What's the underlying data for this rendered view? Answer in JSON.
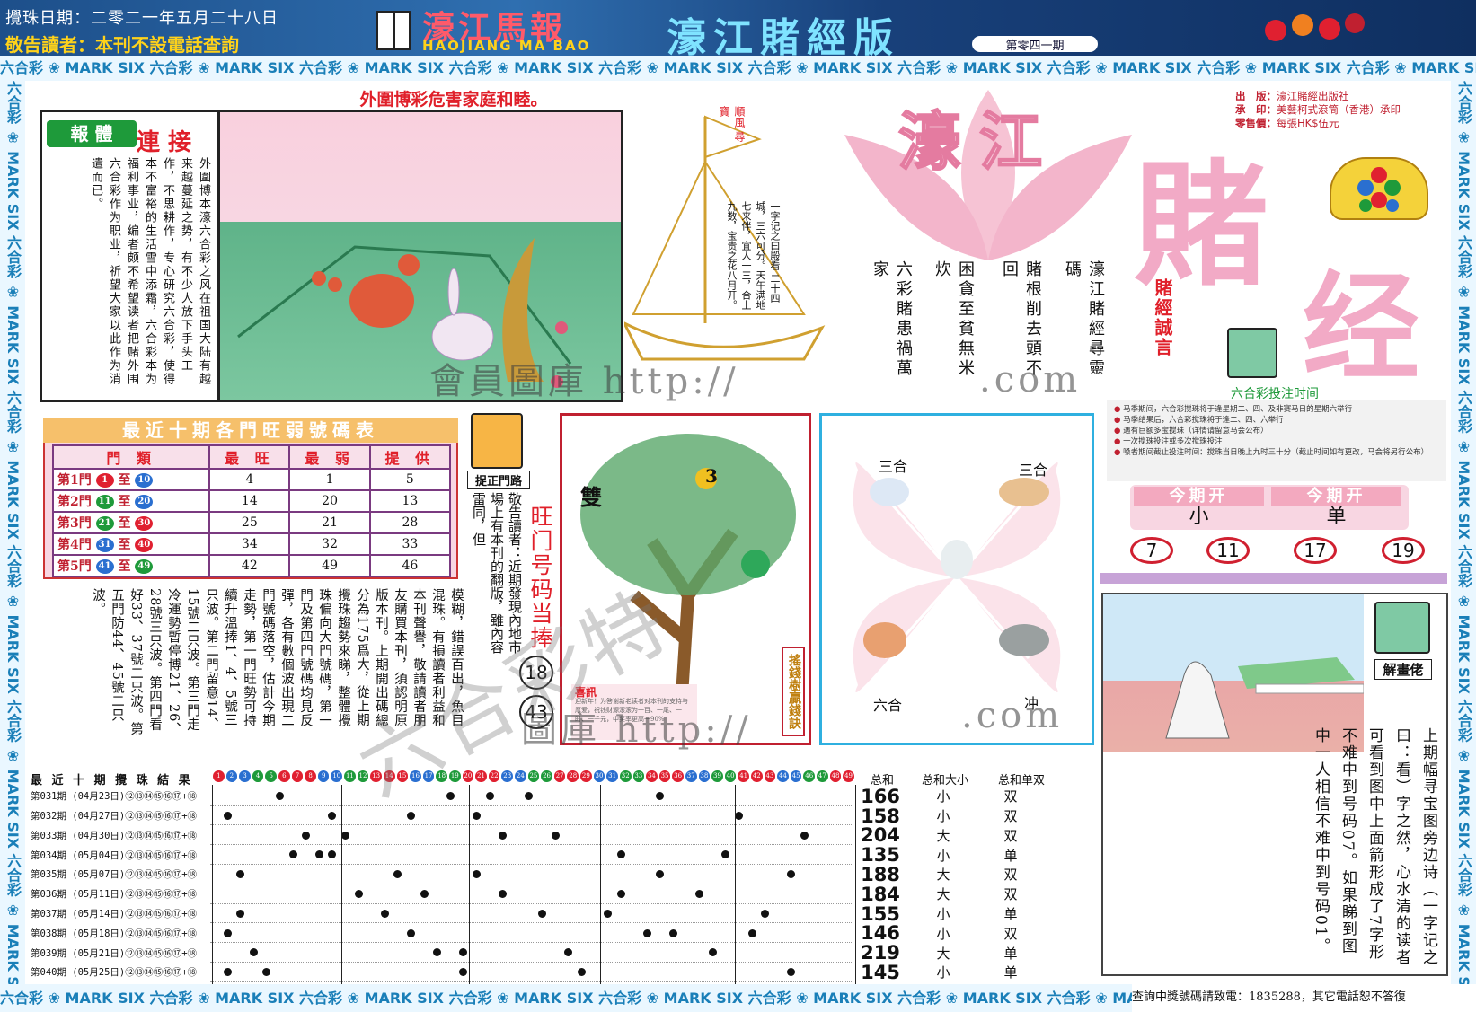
{
  "header": {
    "draw_date": "攪珠日期：二零二一年五月二十八日",
    "notice": "敬告讀者：本刊不設電話查詢",
    "paper_name": "濠江馬報",
    "paper_en": "HAOJIANG MA BAO",
    "edition": "濠江賭經版",
    "issue": "第零四一期"
  },
  "border_text": "六合彩 ❀ MARK SIX 六合彩 ❀ MARK SIX 六合彩 ❀ MARK SIX 六合彩 ❀ MARK SIX 六合彩 ❀ MARK SIX 六合彩 ❀ MARK SIX 六合彩 ❀ MARK SIX 六合彩 ❀ MARK SIX 六合彩 ❀ MARK SIX 六合彩 ❀ MARK SIX",
  "article1": {
    "headline": "外圍博彩危害家庭和睦。",
    "tag": "報 體",
    "tag2": "連 接",
    "text": "外圍博本濠六合彩之风在祖国大陆有越来越蔓延之势，有不少人放下手头工作，不思耕作，专心研究六合彩，使得本不富裕的生活雪中添霜，六合彩本为福利事业，编者颇不希望读者把赌外围六合彩作为职业，祈望大家以此作为消遣而已。"
  },
  "boat": {
    "flag": "順風 尋寶",
    "text": "一字记之曰殿看 二十四城，三六可分。天午满地七来伴，宜人一三，合上九数，宝贵之花八月开。"
  },
  "poems": {
    "p1": "六彩賭患禍萬家",
    "p2": "困貪至貧無米炊",
    "p3": "賭根削去頭不回",
    "p4": "濠江賭經尋靈碼"
  },
  "masthead": {
    "lotus": "濠江",
    "du": "賭",
    "jing": "经",
    "motto": "賭經誠言"
  },
  "publisher": {
    "k1": "出　版：",
    "v1": "濠江賭經出版社",
    "k2": "承　印：",
    "v2": "美藝柯式滾筒（香港）承印",
    "k3": "零售價：",
    "v3": "每張HK$伍元"
  },
  "schedule": {
    "title": "六合彩投注时间",
    "items": [
      "马季期间，六合彩搅珠将于逢星期二、四、及非赛马日的星期六举行",
      "马季结果后，六合彩搅珠将于逢二、四、六举行",
      "遇有巨额多宝搅珠（详情请留意马会公布）",
      "一次搅珠投注或多次搅珠投注",
      "嗓者期间截止投注时间：搅珠当日晚上九时三十分（截止时间如有更改，马会将另行公布）"
    ]
  },
  "this_issue": {
    "h1": "今期开",
    "v1": "小",
    "h2": "今期开",
    "v2": "单",
    "numbers": [
      "7",
      "11",
      "17",
      "19"
    ]
  },
  "table": {
    "title": "最近十期各門旺弱號碼表",
    "headers": [
      "門 類",
      "最 旺",
      "最 弱",
      "提 供"
    ],
    "to": "至",
    "rows": [
      {
        "gate": "第1門",
        "from": "1",
        "to_n": "10",
        "hot": "4",
        "cold": "1",
        "tip": "5"
      },
      {
        "gate": "第2門",
        "from": "11",
        "to_n": "20",
        "hot": "14",
        "cold": "20",
        "tip": "13"
      },
      {
        "gate": "第3門",
        "from": "21",
        "to_n": "30",
        "hot": "25",
        "cold": "21",
        "tip": "28"
      },
      {
        "gate": "第4門",
        "from": "31",
        "to_n": "40",
        "hot": "34",
        "cold": "32",
        "tip": "33"
      },
      {
        "gate": "第5門",
        "from": "41",
        "to_n": "49",
        "hot": "42",
        "cold": "49",
        "tip": "46"
      }
    ]
  },
  "zhuozheng": {
    "label": "捉正門路",
    "apology": "敬告讀者：近期發現內地市場上有本刊的翻版，雖內容雷同，但",
    "wangmen": "旺门号码当捧",
    "n1": "18",
    "n2": "43"
  },
  "column_text": "模糊，錯誤百出，魚目混珠。有損讀者利益和本刊聲譽，敬請讀者朋友購買本刊，須認明原版本刊。上期開出碼總分為175爲大，從上期攪珠趨勢來睇，整體攪珠偏向大門號碼，第一門及第四門號碼均見反彈，各有數個波出現二門號碼落空，估計今期走勢，第一門旺勢可持續升溫捧1、4、5號三只波。第二門留意14、15號二只波。第三門走冷運勢暫停博21、26、28號三只波。第四門看好33、37號二只波。第五門防44、45號二只波。",
  "tree": {
    "shuang": "雙",
    "num": "3",
    "label": "搖錢樹贏錢訣",
    "xixun_title": "喜訊",
    "xixun_text": "迎新年！为答谢新老读者对本刊的支持与厚爱，祝钱财源滚滚为一百、一尾、一时、一千元，中奖率更高一90%"
  },
  "zodiac": {
    "tl": "三合",
    "tr": "三合",
    "bl": "六合",
    "br": "冲"
  },
  "puzzle": {
    "label": "解畫佬",
    "text": "上期幅寻宝图旁边诗（一字记之曰：看）字之然，心水清的读者可看到图中上面箭形成了7字形不难中到号码07。如果睇到图中一人相信不难中到号码01。"
  },
  "results": {
    "title": "最 近 十 期 攪 珠 結 果",
    "sum_h": "总和",
    "dx_h": "总和大小",
    "ds_h": "总和单双",
    "rows": [
      {
        "label": "第031期 (04月23日)⑫⑬⑭⑮⑯⑰+⑱",
        "sum": "166",
        "dx": "小",
        "ds": "双"
      },
      {
        "label": "第032期 (04月27日)⑫⑬⑭⑮⑯⑰+⑱",
        "sum": "158",
        "dx": "小",
        "ds": "双"
      },
      {
        "label": "第033期 (04月30日)⑫⑬⑭⑮⑯⑰+⑱",
        "sum": "204",
        "dx": "大",
        "ds": "双"
      },
      {
        "label": "第034期 (05月04日)⑫⑬⑭⑮⑯⑰+⑱",
        "sum": "135",
        "dx": "小",
        "ds": "单"
      },
      {
        "label": "第035期 (05月07日)⑫⑬⑭⑮⑯⑰+⑱",
        "sum": "188",
        "dx": "大",
        "ds": "双"
      },
      {
        "label": "第036期 (05月11日)⑫⑬⑭⑮⑯⑰+⑱",
        "sum": "184",
        "dx": "大",
        "ds": "双"
      },
      {
        "label": "第037期 (05月14日)⑫⑬⑭⑮⑯⑰+⑱",
        "sum": "155",
        "dx": "小",
        "ds": "单"
      },
      {
        "label": "第038期 (05月18日)⑫⑬⑭⑮⑯⑰+⑱",
        "sum": "146",
        "dx": "小",
        "ds": "双"
      },
      {
        "label": "第039期 (05月21日)⑫⑬⑭⑮⑯⑰+⑱",
        "sum": "219",
        "dx": "大",
        "ds": "单"
      },
      {
        "label": "第040期 (05月25日)⑫⑬⑭⑮⑯⑰+⑱",
        "sum": "145",
        "dx": "小",
        "ds": "单"
      }
    ]
  },
  "hotline": "查詢中獎號碼請致電：1835288，其它電話恕不答復",
  "watermark": {
    "w1": "會員圖庫 http://",
    "w1b": ".com",
    "w2": "圖庫 http://",
    "w2b": ".com",
    "diag": "六合彩特"
  },
  "colors": {
    "red": "#e0202a",
    "green": "#1e9a3a",
    "blue": "#2a6fd0",
    "pink": "#f2aac6"
  }
}
